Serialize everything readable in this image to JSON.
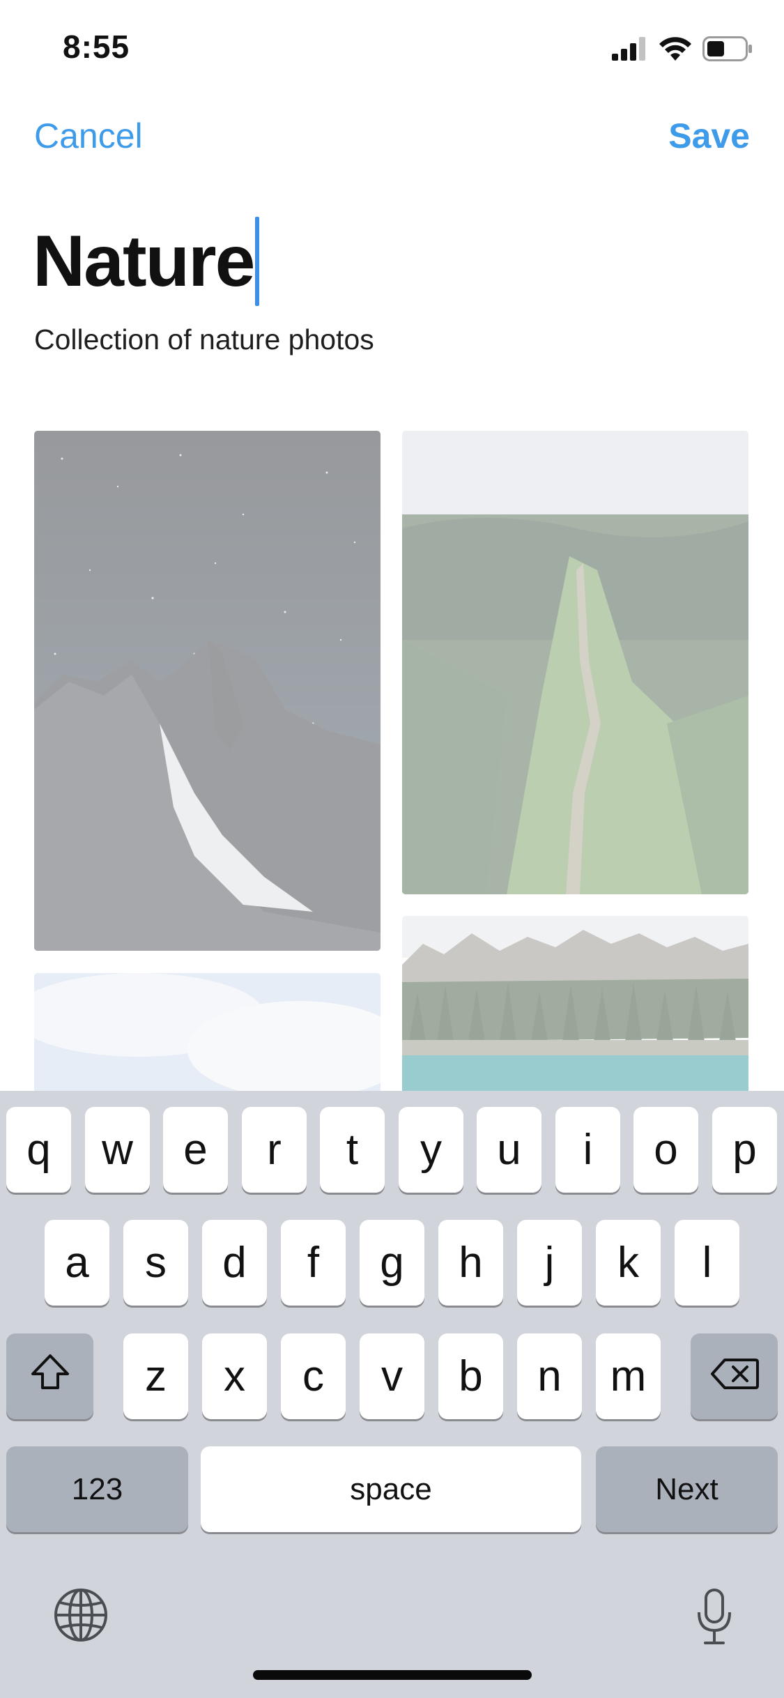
{
  "status_bar": {
    "time": "8:55",
    "icons": [
      "cellular-signal-icon",
      "wifi-icon",
      "battery-icon"
    ]
  },
  "nav": {
    "cancel_label": "Cancel",
    "save_label": "Save"
  },
  "collection": {
    "title_value": "Nature",
    "description": "Collection of nature photos"
  },
  "photos": [
    {
      "name": "starry-mountain-photo"
    },
    {
      "name": "mountain-trail-photo"
    },
    {
      "name": "cloudy-sky-photo"
    },
    {
      "name": "mountain-lake-photo"
    }
  ],
  "keyboard": {
    "row1": [
      "q",
      "w",
      "e",
      "r",
      "t",
      "y",
      "u",
      "i",
      "o",
      "p"
    ],
    "row2": [
      "a",
      "s",
      "d",
      "f",
      "g",
      "h",
      "j",
      "k",
      "l"
    ],
    "row3": [
      "z",
      "x",
      "c",
      "v",
      "b",
      "n",
      "m"
    ],
    "numbers_label": "123",
    "space_label": "space",
    "next_label": "Next",
    "shift_icon": "shift-arrow-icon",
    "delete_icon": "delete-backspace-icon",
    "globe_icon": "globe-icon",
    "mic_icon": "microphone-icon"
  },
  "colors": {
    "accent": "#3d9bea",
    "keyboard_bg": "#d1d4db",
    "key_bg": "#ffffff",
    "special_key_bg": "#abb1bb"
  }
}
